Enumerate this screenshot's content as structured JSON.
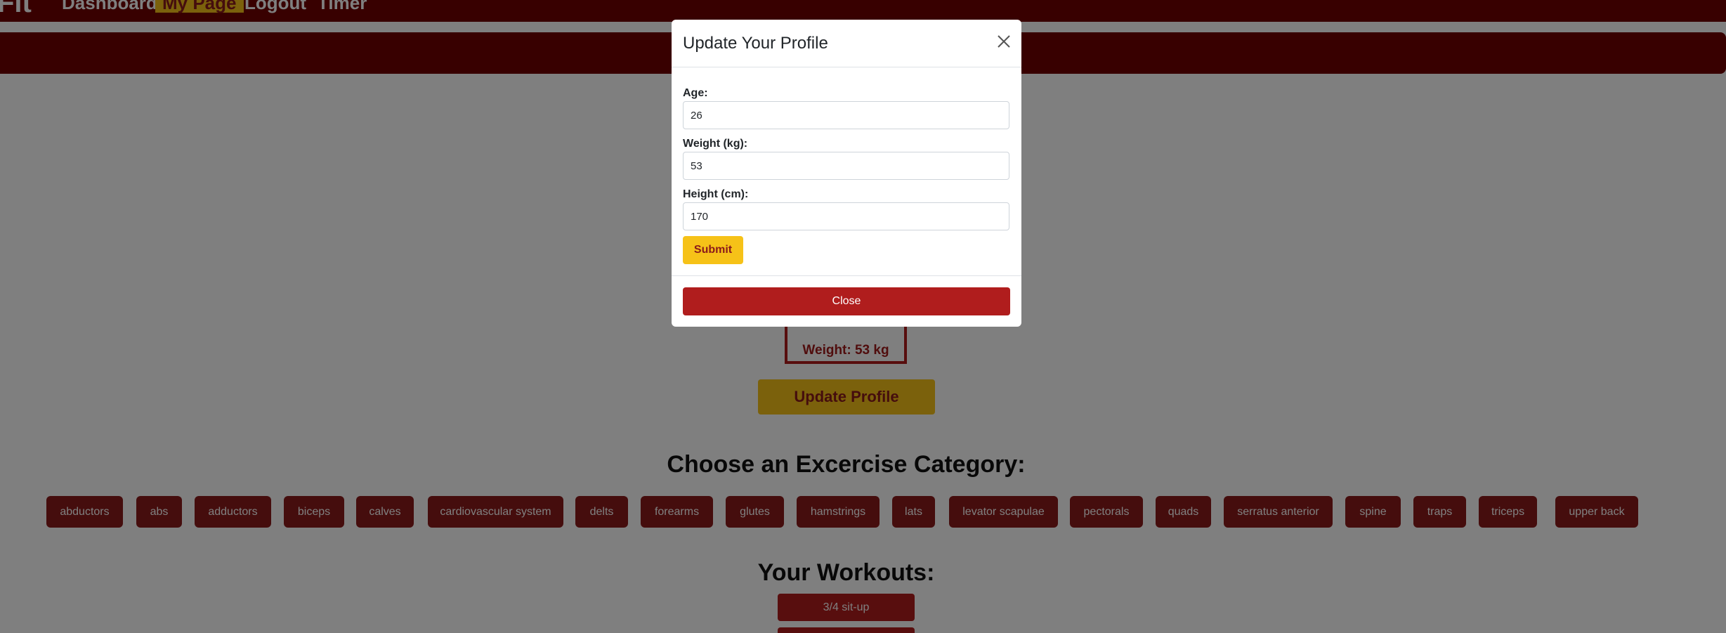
{
  "navbar": {
    "brand": "Fit",
    "links": [
      "Dashboard",
      "My Page",
      "Logout",
      "Timer"
    ],
    "active_index": 1
  },
  "profile": {
    "weight_text": "Weight: 53 kg",
    "update_button": "Update Profile"
  },
  "categories": {
    "title": "Choose an Excercise Category:",
    "items": [
      "abductors",
      "abs",
      "adductors",
      "biceps",
      "calves",
      "cardiovascular system",
      "delts",
      "forearms",
      "glutes",
      "hamstrings",
      "lats",
      "levator scapulae",
      "pectorals",
      "quads",
      "serratus anterior",
      "spine",
      "traps",
      "triceps",
      "upper back"
    ]
  },
  "workouts": {
    "title": "Your Workouts:",
    "items": [
      "3/4 sit-up",
      ""
    ]
  },
  "modal": {
    "title": "Update Your Profile",
    "close_icon": "close-icon",
    "fields": [
      {
        "label": "Age:",
        "value": "26"
      },
      {
        "label": "Weight (kg):",
        "value": "53"
      },
      {
        "label": "Height (cm):",
        "value": "170"
      }
    ],
    "submit_label": "Submit",
    "close_label": "Close"
  },
  "colors": {
    "brand_dark": "#700000",
    "accent_yellow": "#f6c218",
    "button_red": "#b01d1d",
    "category_red": "#8b1a1a"
  }
}
